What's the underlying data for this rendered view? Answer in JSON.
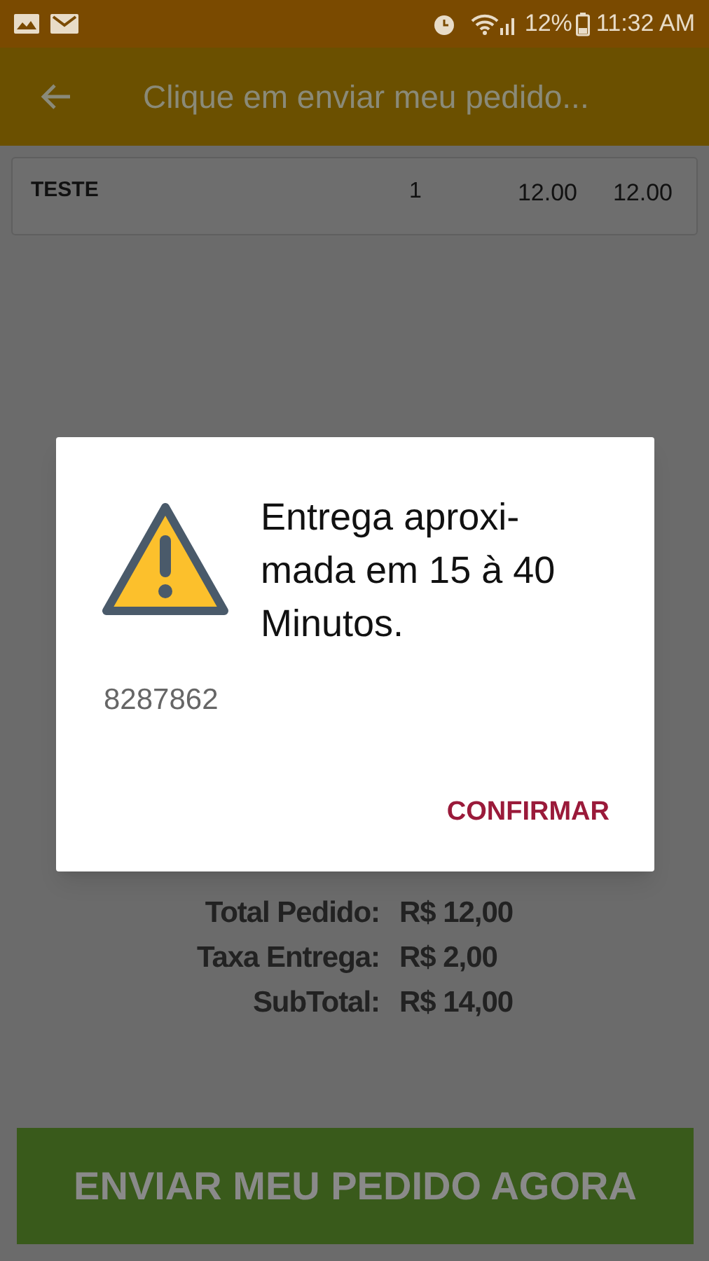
{
  "status_bar": {
    "battery": "12%",
    "time": "11:32 AM"
  },
  "header": {
    "title": "Clique em enviar meu pedido..."
  },
  "items": [
    {
      "name": "TESTE",
      "quantity": "1",
      "price": "12.00",
      "total": "12.00"
    }
  ],
  "totals": [
    {
      "label": "Total Pedido:",
      "value": "R$ 12,00"
    },
    {
      "label": "Taxa Entrega:",
      "value": "R$ 2,00"
    },
    {
      "label": "SubTotal:",
      "value": "R$ 14,00"
    }
  ],
  "send_button": "ENVIAR MEU PEDIDO AGORA",
  "dialog": {
    "message": "Entrega aproxi-\nmada em 15 à 40\nMinutos.",
    "code": "8287862",
    "confirm": "CONFIRMAR"
  }
}
